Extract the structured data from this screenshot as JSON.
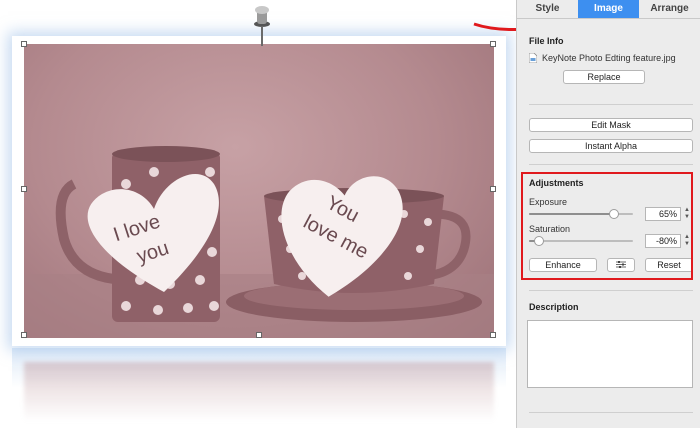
{
  "canvas": {
    "photo": {
      "left_heart_text_line1": "I love",
      "left_heart_text_line2": "you",
      "right_heart_text_line1": "You",
      "right_heart_text_line2": "love me"
    }
  },
  "inspector": {
    "tabs": [
      {
        "label": "Style",
        "active": false
      },
      {
        "label": "Image",
        "active": true
      },
      {
        "label": "Arrange",
        "active": false
      }
    ],
    "file_info": {
      "title": "File Info",
      "filename": "KeyNote Photo Edting feature.jpg",
      "replace_label": "Replace"
    },
    "edit_mask_label": "Edit Mask",
    "instant_alpha_label": "Instant Alpha",
    "adjustments": {
      "title": "Adjustments",
      "exposure": {
        "label": "Exposure",
        "value_text": "65%",
        "level": 0.82
      },
      "saturation": {
        "label": "Saturation",
        "value_text": "-80%",
        "level": 0.1
      },
      "enhance_label": "Enhance",
      "reset_label": "Reset"
    },
    "description": {
      "title": "Description",
      "value": ""
    }
  },
  "colors": {
    "accent": "#3d8ff0",
    "highlight": "#e0191d",
    "photo_pink": "#b48a8f"
  }
}
